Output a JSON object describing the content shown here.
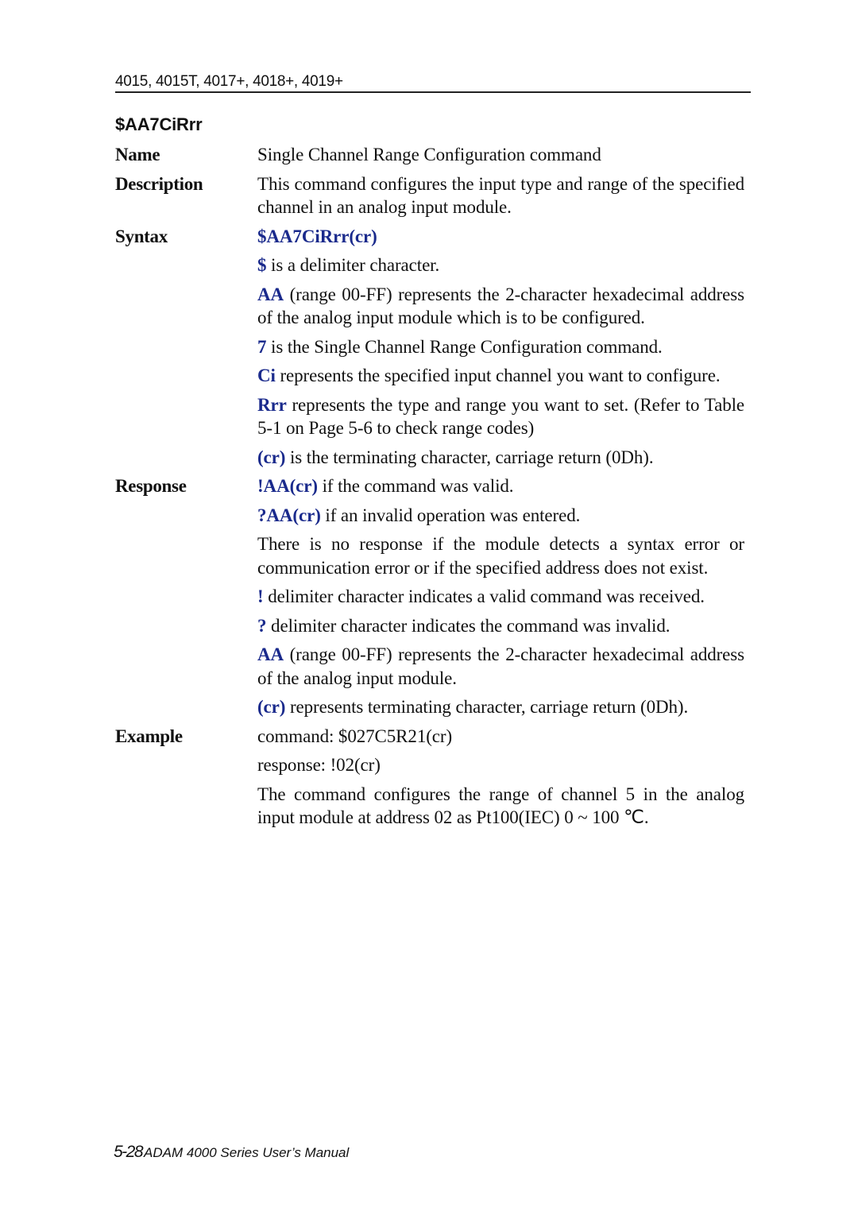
{
  "header": {
    "models": "4015, 4015T, 4017+, 4018+, 4019+"
  },
  "command": {
    "title": "$AA7CiRrr"
  },
  "sections": {
    "name": {
      "label": "Name",
      "text": "Single Channel Range Configuration command"
    },
    "description": {
      "label": "Description",
      "text": "This command configures the input type and range of the specified channel in an analog input module."
    },
    "syntax": {
      "label": "Syntax",
      "format": "$AA7CiRrr(cr)",
      "items": [
        {
          "key": "$",
          "text": " is a delimiter character."
        },
        {
          "key": "AA",
          "text": " (range 00-FF) represents the 2-character hexadecimal address of the analog input module which is to be configured."
        },
        {
          "key": "7",
          "text": " is the Single Channel Range Configuration command."
        },
        {
          "key": "Ci",
          "text": " represents the specified input channel you want to configure."
        },
        {
          "key": "Rrr",
          "text": " represents the type and range you want to set. (Refer to Table 5-1 on Page 5-6 to check range codes)"
        },
        {
          "key": "(cr)",
          "text": " is the terminating character, carriage return (0Dh)."
        }
      ]
    },
    "response": {
      "label": "Response",
      "items": [
        {
          "key": "!AA(cr)",
          "text": " if the command was valid."
        },
        {
          "key": "?AA(cr)",
          "text": " if an invalid operation was entered."
        },
        {
          "key": "",
          "text": "There is no response if the module detects a syntax error or communication error or if the specified address does not exist."
        },
        {
          "key": "!",
          "text": " delimiter character indicates a valid command was received."
        },
        {
          "key": "?",
          "text": " delimiter character indicates the command was invalid."
        },
        {
          "key": "AA",
          "text": " (range 00-FF) represents the 2-character hexadecimal address of the analog input module."
        },
        {
          "key": "(cr)",
          "text": " represents terminating character, carriage return (0Dh)."
        }
      ]
    },
    "example": {
      "label": "Example",
      "command": "command: $027C5R21(cr)",
      "response": "response: !02(cr)",
      "explanation": "The command configures the range of channel 5 in the analog input module at address 02 as Pt100(IEC) 0 ~ 100 ℃."
    }
  },
  "footer": {
    "page": "5-28",
    "title": "ADAM 4000 Series User’s Manual"
  },
  "colors": {
    "keyword": "#1a2a8c",
    "text": "#111111"
  }
}
